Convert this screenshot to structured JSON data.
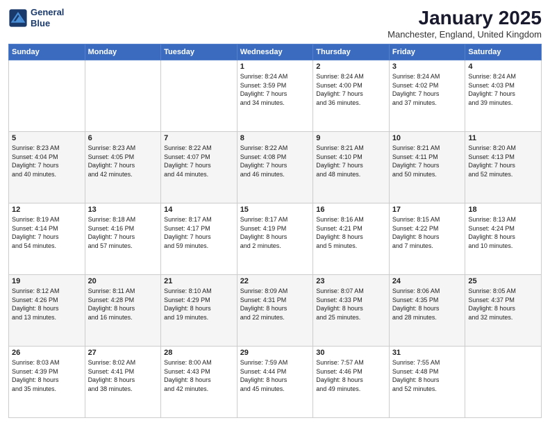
{
  "logo": {
    "line1": "General",
    "line2": "Blue"
  },
  "title": "January 2025",
  "location": "Manchester, England, United Kingdom",
  "days_of_week": [
    "Sunday",
    "Monday",
    "Tuesday",
    "Wednesday",
    "Thursday",
    "Friday",
    "Saturday"
  ],
  "weeks": [
    [
      {
        "day": "",
        "text": ""
      },
      {
        "day": "",
        "text": ""
      },
      {
        "day": "",
        "text": ""
      },
      {
        "day": "1",
        "text": "Sunrise: 8:24 AM\nSunset: 3:59 PM\nDaylight: 7 hours\nand 34 minutes."
      },
      {
        "day": "2",
        "text": "Sunrise: 8:24 AM\nSunset: 4:00 PM\nDaylight: 7 hours\nand 36 minutes."
      },
      {
        "day": "3",
        "text": "Sunrise: 8:24 AM\nSunset: 4:02 PM\nDaylight: 7 hours\nand 37 minutes."
      },
      {
        "day": "4",
        "text": "Sunrise: 8:24 AM\nSunset: 4:03 PM\nDaylight: 7 hours\nand 39 minutes."
      }
    ],
    [
      {
        "day": "5",
        "text": "Sunrise: 8:23 AM\nSunset: 4:04 PM\nDaylight: 7 hours\nand 40 minutes."
      },
      {
        "day": "6",
        "text": "Sunrise: 8:23 AM\nSunset: 4:05 PM\nDaylight: 7 hours\nand 42 minutes."
      },
      {
        "day": "7",
        "text": "Sunrise: 8:22 AM\nSunset: 4:07 PM\nDaylight: 7 hours\nand 44 minutes."
      },
      {
        "day": "8",
        "text": "Sunrise: 8:22 AM\nSunset: 4:08 PM\nDaylight: 7 hours\nand 46 minutes."
      },
      {
        "day": "9",
        "text": "Sunrise: 8:21 AM\nSunset: 4:10 PM\nDaylight: 7 hours\nand 48 minutes."
      },
      {
        "day": "10",
        "text": "Sunrise: 8:21 AM\nSunset: 4:11 PM\nDaylight: 7 hours\nand 50 minutes."
      },
      {
        "day": "11",
        "text": "Sunrise: 8:20 AM\nSunset: 4:13 PM\nDaylight: 7 hours\nand 52 minutes."
      }
    ],
    [
      {
        "day": "12",
        "text": "Sunrise: 8:19 AM\nSunset: 4:14 PM\nDaylight: 7 hours\nand 54 minutes."
      },
      {
        "day": "13",
        "text": "Sunrise: 8:18 AM\nSunset: 4:16 PM\nDaylight: 7 hours\nand 57 minutes."
      },
      {
        "day": "14",
        "text": "Sunrise: 8:17 AM\nSunset: 4:17 PM\nDaylight: 7 hours\nand 59 minutes."
      },
      {
        "day": "15",
        "text": "Sunrise: 8:17 AM\nSunset: 4:19 PM\nDaylight: 8 hours\nand 2 minutes."
      },
      {
        "day": "16",
        "text": "Sunrise: 8:16 AM\nSunset: 4:21 PM\nDaylight: 8 hours\nand 5 minutes."
      },
      {
        "day": "17",
        "text": "Sunrise: 8:15 AM\nSunset: 4:22 PM\nDaylight: 8 hours\nand 7 minutes."
      },
      {
        "day": "18",
        "text": "Sunrise: 8:13 AM\nSunset: 4:24 PM\nDaylight: 8 hours\nand 10 minutes."
      }
    ],
    [
      {
        "day": "19",
        "text": "Sunrise: 8:12 AM\nSunset: 4:26 PM\nDaylight: 8 hours\nand 13 minutes."
      },
      {
        "day": "20",
        "text": "Sunrise: 8:11 AM\nSunset: 4:28 PM\nDaylight: 8 hours\nand 16 minutes."
      },
      {
        "day": "21",
        "text": "Sunrise: 8:10 AM\nSunset: 4:29 PM\nDaylight: 8 hours\nand 19 minutes."
      },
      {
        "day": "22",
        "text": "Sunrise: 8:09 AM\nSunset: 4:31 PM\nDaylight: 8 hours\nand 22 minutes."
      },
      {
        "day": "23",
        "text": "Sunrise: 8:07 AM\nSunset: 4:33 PM\nDaylight: 8 hours\nand 25 minutes."
      },
      {
        "day": "24",
        "text": "Sunrise: 8:06 AM\nSunset: 4:35 PM\nDaylight: 8 hours\nand 28 minutes."
      },
      {
        "day": "25",
        "text": "Sunrise: 8:05 AM\nSunset: 4:37 PM\nDaylight: 8 hours\nand 32 minutes."
      }
    ],
    [
      {
        "day": "26",
        "text": "Sunrise: 8:03 AM\nSunset: 4:39 PM\nDaylight: 8 hours\nand 35 minutes."
      },
      {
        "day": "27",
        "text": "Sunrise: 8:02 AM\nSunset: 4:41 PM\nDaylight: 8 hours\nand 38 minutes."
      },
      {
        "day": "28",
        "text": "Sunrise: 8:00 AM\nSunset: 4:43 PM\nDaylight: 8 hours\nand 42 minutes."
      },
      {
        "day": "29",
        "text": "Sunrise: 7:59 AM\nSunset: 4:44 PM\nDaylight: 8 hours\nand 45 minutes."
      },
      {
        "day": "30",
        "text": "Sunrise: 7:57 AM\nSunset: 4:46 PM\nDaylight: 8 hours\nand 49 minutes."
      },
      {
        "day": "31",
        "text": "Sunrise: 7:55 AM\nSunset: 4:48 PM\nDaylight: 8 hours\nand 52 minutes."
      },
      {
        "day": "",
        "text": ""
      }
    ]
  ]
}
